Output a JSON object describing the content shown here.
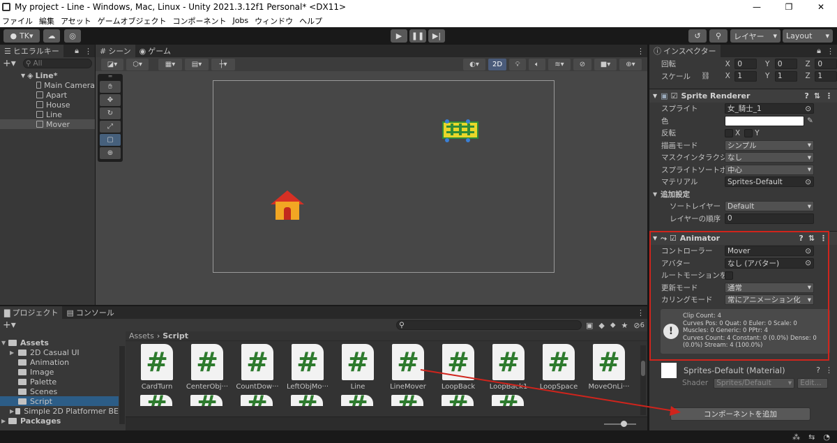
{
  "window": {
    "title": "My project - Line - Windows, Mac, Linux - Unity 2021.3.12f1 Personal* <DX11>",
    "minimize": "—",
    "maximize": "❐",
    "close": "✕"
  },
  "menu": [
    "ファイル",
    "編集",
    "アセット",
    "ゲームオブジェクト",
    "コンポーネント",
    "Jobs",
    "ウィンドウ",
    "ヘルプ"
  ],
  "toolbar": {
    "account": "TK",
    "layers": "レイヤー",
    "layout": "Layout"
  },
  "hierarchy": {
    "tab": "ヒエラルキー",
    "search_placeholder": "All",
    "scene": "Line*",
    "items": [
      "Main Camera",
      "Apart",
      "House",
      "Line",
      "Mover"
    ],
    "selected": "Mover"
  },
  "scene": {
    "tabs": [
      "シーン",
      "ゲーム"
    ],
    "mode2d": "2D"
  },
  "inspector": {
    "tab": "インスペクター",
    "rotation": {
      "label": "回転",
      "x": "0",
      "y": "0",
      "z": "0"
    },
    "scale": {
      "label": "スケール",
      "x": "1",
      "y": "1",
      "z": "1"
    },
    "sprite_renderer": {
      "title": "Sprite Renderer",
      "fields": {
        "sprite_label": "スプライト",
        "sprite": "女_騎士_1",
        "color_label": "色",
        "flip_label": "反転",
        "flip_x": "X",
        "flip_y": "Y",
        "draw_mode_label": "描画モード",
        "draw_mode": "シンプル",
        "mask_label": "マスクインタラクション",
        "mask": "なし",
        "pivot_label": "スプライトソートポイント",
        "pivot": "中心",
        "material_label": "マテリアル",
        "material": "Sprites-Default",
        "additional": "追加設定",
        "sort_layer_label": "ソートレイヤー",
        "sort_layer": "Default",
        "order_label": "レイヤーの順序",
        "order": "0"
      }
    },
    "animator": {
      "title": "Animator",
      "controller_label": "コントローラー",
      "controller": "Mover",
      "avatar_label": "アバター",
      "avatar": "なし (アバター)",
      "root_motion_label": "ルートモーションを適用",
      "update_label": "更新モード",
      "update": "通常",
      "culling_label": "カリングモード",
      "culling": "常にアニメーション化",
      "info": [
        "Clip Count: 4",
        "Curves Pos: 0 Quat: 0 Euler: 0 Scale: 0",
        "Muscles: 0 Generic: 0 PPtr: 4",
        "Curves Count: 4 Constant: 0 (0.0%) Dense: 0",
        "(0.0%) Stream: 4 (100.0%)"
      ]
    },
    "material": {
      "name": "Sprites-Default (Material)",
      "shader_label": "Shader",
      "shader": "Sprites/Default",
      "edit": "Edit..."
    },
    "add_component": "コンポーネントを追加"
  },
  "project": {
    "tabs": [
      "プロジェクト",
      "コンソール"
    ],
    "count": "6",
    "folders": [
      {
        "name": "Assets",
        "level": 0,
        "bold": true
      },
      {
        "name": "2D Casual UI",
        "level": 1
      },
      {
        "name": "Animation",
        "level": 1
      },
      {
        "name": "Image",
        "level": 1
      },
      {
        "name": "Palette",
        "level": 1
      },
      {
        "name": "Scenes",
        "level": 1
      },
      {
        "name": "Script",
        "level": 1,
        "selected": true
      },
      {
        "name": "Simple 2D Platformer BE",
        "level": 1
      },
      {
        "name": "Packages",
        "level": 0,
        "bold": true
      }
    ],
    "breadcrumb": [
      "Assets",
      "Script"
    ],
    "assets": [
      "CardTurn",
      "CenterObj···",
      "CountDow···",
      "LeftObjMo···",
      "Line",
      "LineMover",
      "LoopBack",
      "LoopBack1",
      "LoopSpace",
      "MoveOnLi···"
    ]
  }
}
